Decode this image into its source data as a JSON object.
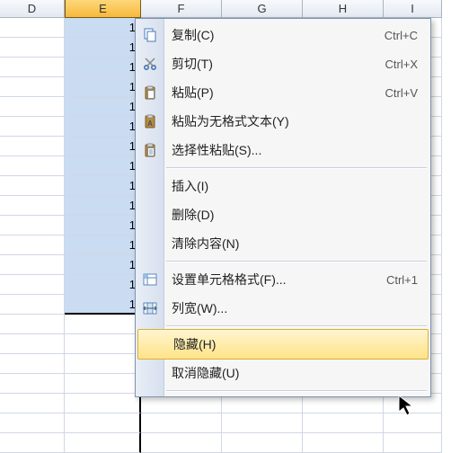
{
  "columns": [
    {
      "letter": "D",
      "class": "wD",
      "selected": false
    },
    {
      "letter": "E",
      "class": "wE",
      "selected": true
    },
    {
      "letter": "F",
      "class": "wF",
      "selected": false
    },
    {
      "letter": "G",
      "class": "wG",
      "selected": false
    },
    {
      "letter": "H",
      "class": "wH",
      "selected": false
    },
    {
      "letter": "I",
      "class": "wI",
      "selected": false
    }
  ],
  "selected_column_value": "1",
  "visible_filled_rows": 15,
  "menu": {
    "items": {
      "copy": {
        "label": "复制(C)",
        "shortcut": "Ctrl+C"
      },
      "cut": {
        "label": "剪切(T)",
        "shortcut": "Ctrl+X"
      },
      "paste": {
        "label": "粘贴(P)",
        "shortcut": "Ctrl+V"
      },
      "paste_unformatted": {
        "label": "粘贴为无格式文本(Y)"
      },
      "paste_special": {
        "label": "选择性粘贴(S)..."
      },
      "insert": {
        "label": "插入(I)"
      },
      "delete": {
        "label": "删除(D)"
      },
      "clear": {
        "label": "清除内容(N)"
      },
      "format": {
        "label": "设置单元格格式(F)...",
        "shortcut": "Ctrl+1"
      },
      "colwidth": {
        "label": "列宽(W)..."
      },
      "hide": {
        "label": "隐藏(H)"
      },
      "unhide": {
        "label": "取消隐藏(U)"
      }
    },
    "highlighted": "hide"
  }
}
